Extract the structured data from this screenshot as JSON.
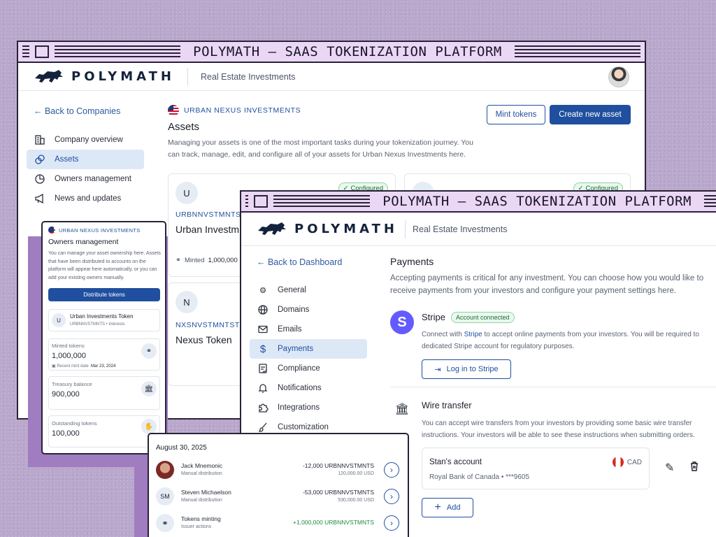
{
  "title": "POLYMATH – SAAS TOKENIZATION PLATFORM",
  "brand": "POLYMATH",
  "breadcrumb": "Real Estate Investments",
  "colors": {
    "primary": "#1f4f9e",
    "stripe": "#635bff",
    "success": "#1d6e38"
  },
  "assets_page": {
    "back": "← Back to Companies",
    "nav": [
      {
        "label": "Company overview",
        "icon": "building-icon"
      },
      {
        "label": "Assets",
        "icon": "coins-icon"
      },
      {
        "label": "Owners management",
        "icon": "pie-chart-icon"
      },
      {
        "label": "News and updates",
        "icon": "megaphone-icon"
      }
    ],
    "company": "URBAN NEXUS INVESTMENTS",
    "heading": "Assets",
    "description": "Managing your assets is one of the most important tasks during your tokenization journey. You can track, manage, edit, and configure all of your assets for Urban Nexus Investments here.",
    "mint_button": "Mint tokens",
    "create_button": "Create new asset",
    "cards": [
      {
        "initial": "U",
        "ticker": "URBNNVSTMNTS",
        "name": "Urban Investm",
        "badge": "Configured",
        "minted_label": "Minted",
        "minted_value": "1,000,000"
      },
      {
        "initial": "N",
        "ticker": "NXSNVSTMNTST",
        "name": "Nexus Token"
      }
    ],
    "second_badge": "Configured"
  },
  "owners": {
    "company": "URBAN NEXUS INVESTMENTS",
    "heading": "Owners management",
    "description": "You can manage your asset ownership here. Assets that have been distributed to accounts on the platform will appear here automatically, or you can add your existing owners manually.",
    "button": "Distribute tokens",
    "token": {
      "initial": "U",
      "name": "Urban Investments Token",
      "ticker": "URBNNVSTMNTS",
      "type": "Interests"
    },
    "stats": [
      {
        "label": "Minted tokens",
        "value": "1,000,000",
        "sub_label": "Recent mint date",
        "sub_value": "Mar 23, 2024",
        "icon": "coins-icon"
      },
      {
        "label": "Treasury balance",
        "value": "900,000",
        "icon": "bank-icon"
      },
      {
        "label": "Outstanding tokens",
        "value": "100,000",
        "icon": "hand-coins-icon"
      }
    ]
  },
  "activity": {
    "date": "August 30, 2025",
    "items": [
      {
        "avatar": "",
        "name": "Jack Mnemonic",
        "sub": "Manual distribution",
        "amount": "-12,000 URBNNVSTMNTS",
        "usd": "120,000.00 USD"
      },
      {
        "avatar": "SM",
        "name": "Steven Michaelson",
        "sub": "Manual distribution",
        "amount": "-53,000 URBNNVSTMNTS",
        "usd": "530,000.00 USD"
      },
      {
        "avatar": "",
        "name": "Tokens minting",
        "sub": "Issuer actions",
        "amount": "+1,000,000 URBNNVSTMNTS",
        "usd": ""
      }
    ]
  },
  "payments_page": {
    "back": "← Back to Dashboard",
    "nav": [
      {
        "label": "General",
        "icon": "gear-icon"
      },
      {
        "label": "Domains",
        "icon": "globe-icon"
      },
      {
        "label": "Emails",
        "icon": "mail-icon"
      },
      {
        "label": "Payments",
        "icon": "dollar-icon"
      },
      {
        "label": "Compliance",
        "icon": "checklist-icon"
      },
      {
        "label": "Notifications",
        "icon": "bell-icon"
      },
      {
        "label": "Integrations",
        "icon": "puzzle-icon"
      },
      {
        "label": "Customization",
        "icon": "brush-icon"
      }
    ],
    "heading": "Payments",
    "description": "Accepting payments is critical for any investment. You can choose how you would like to receive payments from your investors and configure your payment settings here.",
    "stripe": {
      "logo": "S",
      "title": "Stripe",
      "badge": "Account connected",
      "desc_pre": "Connect with ",
      "desc_link": "Stripe",
      "desc_post": " to accept online payments from your investors. You will be required to",
      "desc_line2": "dedicated Stripe account for regulatory purposes.",
      "button": "Log in to Stripe"
    },
    "wire": {
      "title": "Wire transfer",
      "desc": "You can accept wire transfers from your investors by providing some basic wire transfer instructions. Your investors will be able to see these instructions when submitting orders.",
      "account_name": "Stan's account",
      "currency": "CAD",
      "bank": "Royal Bank of Canada • ***9605",
      "add": "Add"
    }
  }
}
